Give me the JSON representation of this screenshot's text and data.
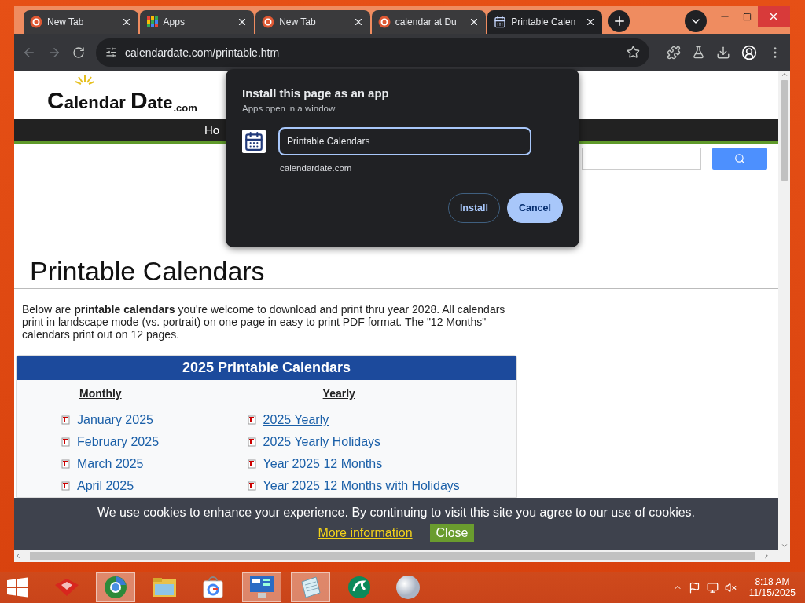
{
  "tabs": [
    {
      "title": "New Tab",
      "kind": "duck",
      "selected": false
    },
    {
      "title": "Apps",
      "kind": "apps",
      "selected": false
    },
    {
      "title": "New Tab",
      "kind": "duck",
      "selected": false
    },
    {
      "title": "calendar at Du",
      "kind": "duck",
      "selected": false
    },
    {
      "title": "Printable Calen",
      "kind": "calendar",
      "selected": true
    }
  ],
  "address_bar": {
    "url": "calendardate.com/printable.htm"
  },
  "page": {
    "logo": {
      "word_1": "Calendar",
      "word_2": "Date",
      "suffix": ".com"
    },
    "nav": {
      "items": [
        "Ho"
      ]
    },
    "heading": "Printable Calendars",
    "intro": "Below are **printable calendars** you're welcome to download and print thru year 2028. All calendars print in landscape mode (vs. portrait) on one page in easy to print PDF format. The \"12 Months\" calendars print out on 12 pages.",
    "calendar_box": {
      "title": "2025 Printable Calendars",
      "columns": [
        {
          "heading": "Monthly",
          "links": [
            {
              "label": "January 2025",
              "hovered": false
            },
            {
              "label": "February 2025",
              "hovered": false
            },
            {
              "label": "March 2025",
              "hovered": false
            },
            {
              "label": "April 2025",
              "hovered": false
            }
          ]
        },
        {
          "heading": "Yearly",
          "links": [
            {
              "label": "2025 Yearly",
              "hovered": true
            },
            {
              "label": "2025 Yearly Holidays",
              "hovered": false
            },
            {
              "label": "Year 2025 12 Months",
              "hovered": false
            },
            {
              "label": "Year 2025 12 Months with Holidays",
              "hovered": false
            }
          ]
        }
      ]
    },
    "cookie_banner": {
      "text": "We use cookies to enhance your experience. By continuing to visit this site you agree to our use of cookies.",
      "link": "More information",
      "button": "Close"
    }
  },
  "dialog": {
    "title": "Install this page as an app",
    "subtitle": "Apps open in a window",
    "name_field": {
      "value": "Printable Calendars"
    },
    "origin": "calendardate.com",
    "buttons": [
      {
        "label": "Install",
        "kind": "outline"
      },
      {
        "label": "Cancel",
        "kind": "filled"
      }
    ]
  },
  "taskbar": {
    "apps": [
      {
        "kind": "redbox",
        "active": false
      },
      {
        "kind": "chrome",
        "active": true
      },
      {
        "kind": "folder",
        "active": false
      },
      {
        "kind": "store",
        "active": false
      },
      {
        "kind": "control",
        "active": true
      },
      {
        "kind": "notepad",
        "active": true
      },
      {
        "kind": "green",
        "active": false
      },
      {
        "kind": "sphere",
        "active": false
      }
    ],
    "clock": {
      "time": "8:18 AM",
      "date": "11/15/2025"
    }
  }
}
